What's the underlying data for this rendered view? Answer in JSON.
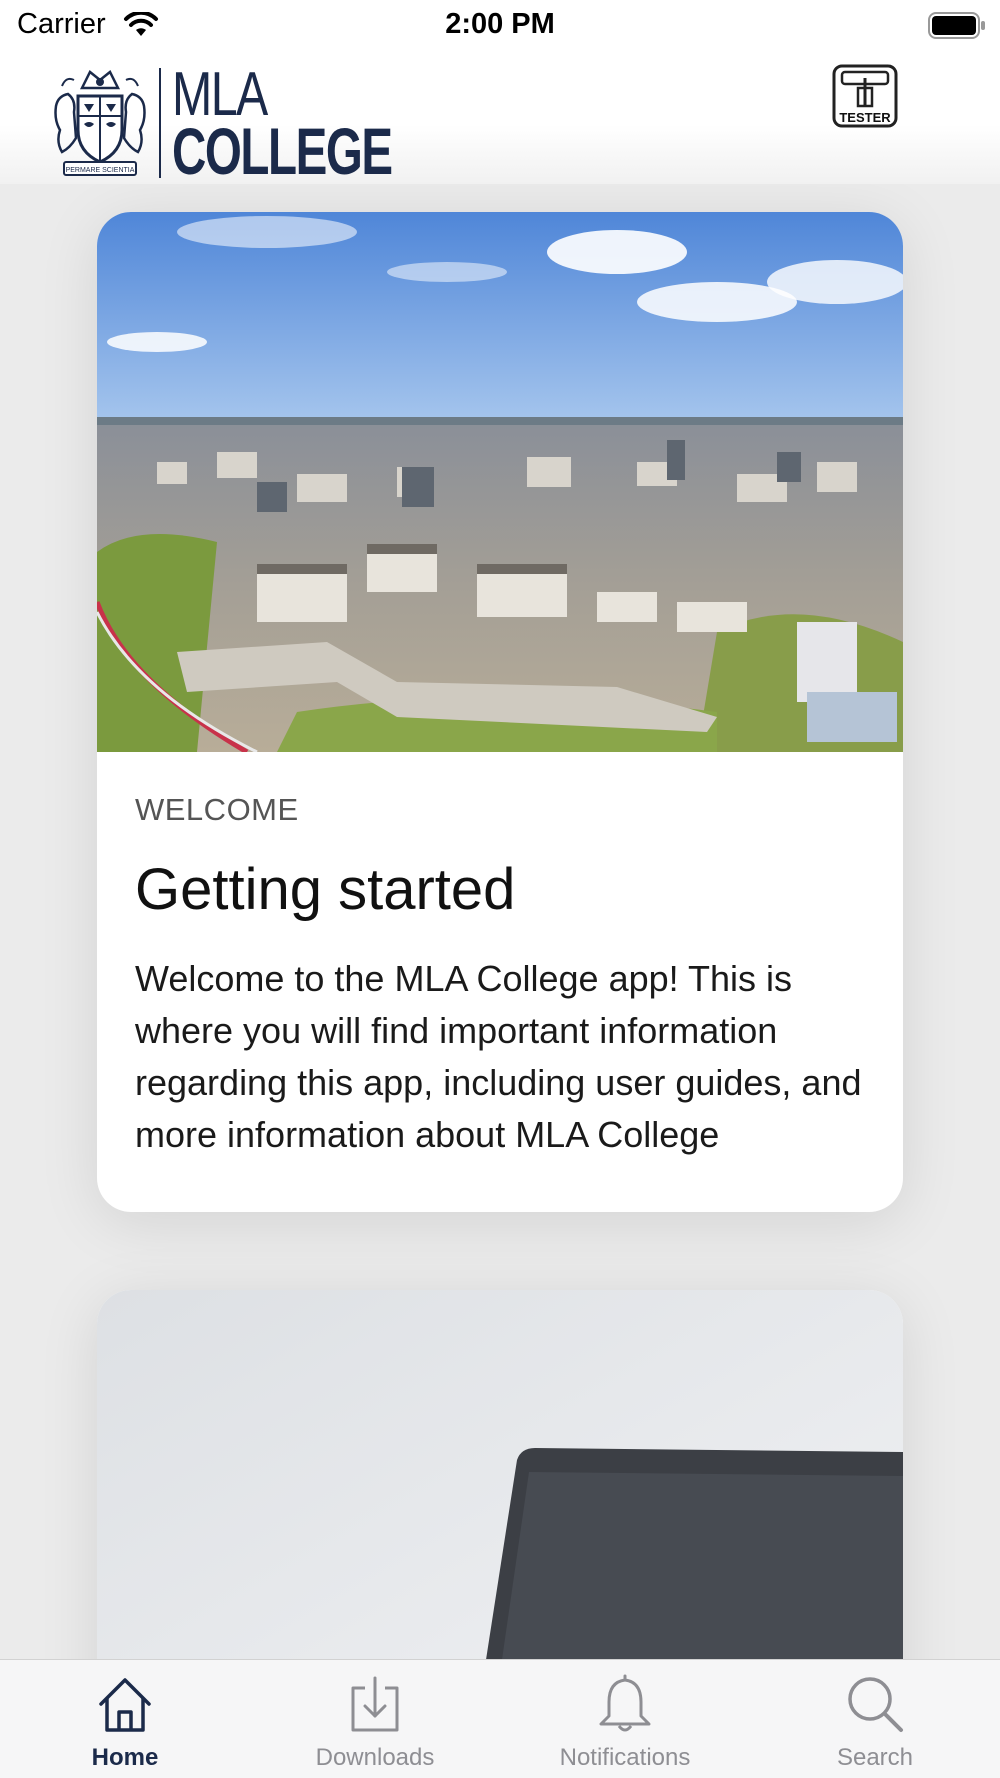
{
  "status_bar": {
    "carrier": "Carrier",
    "time": "2:00 PM"
  },
  "header": {
    "logo_line1": "MLA",
    "logo_line2": "COLLEGE",
    "logo_motto": "PERMARE SCIENTIA",
    "tester_badge": "TESTER"
  },
  "cards": [
    {
      "eyebrow": "WELCOME",
      "title": "Getting started",
      "text": "Welcome to the MLA College app! This is where you will find important information regarding this app, including user guides, and more information about MLA College"
    }
  ],
  "tab_bar": {
    "items": [
      {
        "label": "Home",
        "icon": "home-icon",
        "active": true
      },
      {
        "label": "Downloads",
        "icon": "download-icon",
        "active": false
      },
      {
        "label": "Notifications",
        "icon": "bell-icon",
        "active": false
      },
      {
        "label": "Search",
        "icon": "search-icon",
        "active": false
      }
    ]
  },
  "colors": {
    "brand_navy": "#1b2a4a",
    "tab_inactive": "#8e8e93",
    "background": "#ebebeb",
    "card": "#ffffff"
  }
}
